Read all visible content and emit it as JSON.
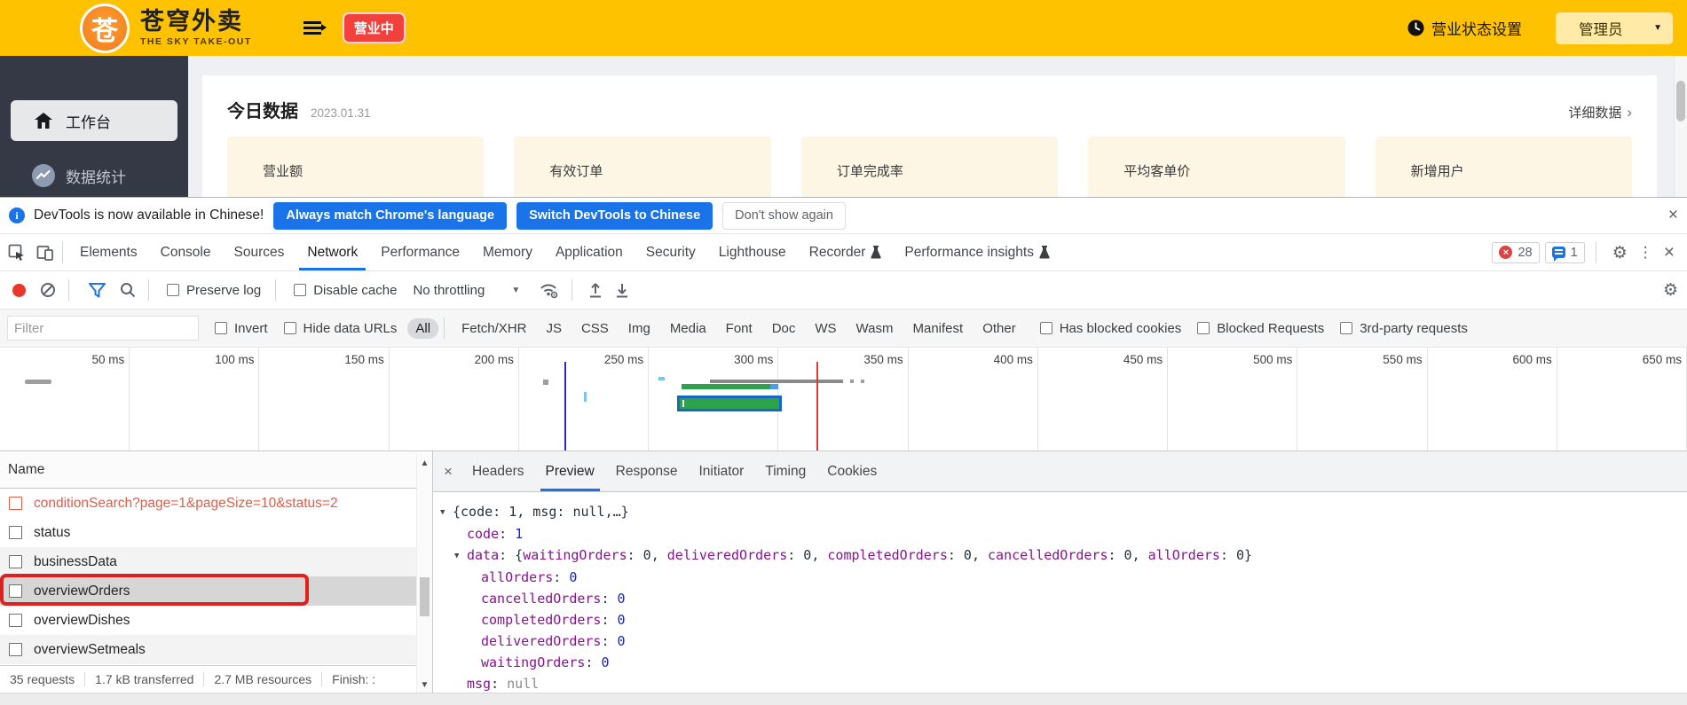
{
  "colors": {
    "brand_yellow": "#ffc200",
    "badge_red": "#f2413d",
    "sidebar_dark": "#353845",
    "card_cream": "#fdf6e4",
    "devtools_blue": "#1a73e8",
    "error_red": "#e05d47",
    "annotation_red": "#e01f1f",
    "waterfall_green": "#2ca24c"
  },
  "app": {
    "brand": {
      "logo_char": "苍",
      "title": "苍穹外卖",
      "subtitle": "THE SKY TAKE-OUT"
    },
    "status_badge": "营业中",
    "business_status_label": "营业状态设置",
    "user_menu": "管理员",
    "sidebar": [
      {
        "label": "工作台",
        "icon": "home-icon",
        "active": true
      },
      {
        "label": "数据统计",
        "icon": "line-chart-icon",
        "active": false
      }
    ],
    "main": {
      "section_title": "今日数据",
      "date": "2023.01.31",
      "detail_link": "详细数据",
      "detail_chevron": "›",
      "cards": [
        "营业额",
        "有效订单",
        "订单完成率",
        "平均客单价",
        "新增用户"
      ]
    }
  },
  "devtools": {
    "infobar": {
      "message": "DevTools is now available in Chinese!",
      "buttons": [
        {
          "label": "Always match Chrome's language",
          "style": "primary"
        },
        {
          "label": "Switch DevTools to Chinese",
          "style": "primary"
        },
        {
          "label": "Don't show again",
          "style": "secondary"
        }
      ],
      "close": "×"
    },
    "tabs": {
      "items": [
        "Elements",
        "Console",
        "Sources",
        "Network",
        "Performance",
        "Memory",
        "Application",
        "Security",
        "Lighthouse",
        "Recorder",
        "Performance insights"
      ],
      "selected": "Network",
      "flask_tabs": [
        "Recorder",
        "Performance insights"
      ],
      "error_count": "28",
      "issue_count": "1",
      "close": "×"
    },
    "toolbar": {
      "preserve_log": "Preserve log",
      "disable_cache": "Disable cache",
      "throttling": "No throttling"
    },
    "filterbar": {
      "placeholder": "Filter",
      "invert": "Invert",
      "hide_data_urls": "Hide data URLs",
      "types": [
        "All",
        "Fetch/XHR",
        "JS",
        "CSS",
        "Img",
        "Media",
        "Font",
        "Doc",
        "WS",
        "Wasm",
        "Manifest",
        "Other"
      ],
      "selected_type": "All",
      "more": [
        "Has blocked cookies",
        "Blocked Requests",
        "3rd-party requests"
      ]
    },
    "timeline": {
      "labels": [
        "50 ms",
        "100 ms",
        "150 ms",
        "200 ms",
        "250 ms",
        "300 ms",
        "350 ms",
        "400 ms",
        "450 ms",
        "500 ms",
        "550 ms",
        "600 ms",
        "650 ms"
      ]
    },
    "requests": {
      "header": "Name",
      "rows": [
        {
          "label": "conditionSearch?page=1&pageSize=10&status=2",
          "error": true
        },
        {
          "label": "status"
        },
        {
          "label": "businessData",
          "shaded": true
        },
        {
          "label": "overviewOrders",
          "selected": true,
          "annotated": true
        },
        {
          "label": "overviewDishes"
        },
        {
          "label": "overviewSetmeals",
          "shaded": true
        }
      ]
    },
    "preview": {
      "tabs": [
        "Headers",
        "Preview",
        "Response",
        "Initiator",
        "Timing",
        "Cookies"
      ],
      "selected": "Preview",
      "close": "×",
      "json": [
        {
          "indent": 0,
          "expanded": true,
          "parts": [
            [
              "{code: 1, msg: null,…}",
              "jp"
            ]
          ]
        },
        {
          "indent": 1,
          "expanded": false,
          "parts": [
            [
              "code",
              "jk"
            ],
            [
              ": ",
              "jp"
            ],
            [
              "1",
              "jn"
            ]
          ]
        },
        {
          "indent": 1,
          "expanded": true,
          "parts": [
            [
              "data",
              "jk"
            ],
            [
              ": {",
              "jp"
            ],
            [
              "waitingOrders",
              "jk"
            ],
            [
              ": 0, ",
              "jp"
            ],
            [
              "deliveredOrders",
              "jk"
            ],
            [
              ": 0, ",
              "jp"
            ],
            [
              "completedOrders",
              "jk"
            ],
            [
              ": 0, ",
              "jp"
            ],
            [
              "cancelledOrders",
              "jk"
            ],
            [
              ": 0, ",
              "jp"
            ],
            [
              "allOrders",
              "jk"
            ],
            [
              ": 0",
              "jp"
            ],
            [
              "}",
              "jp"
            ]
          ]
        },
        {
          "indent": 2,
          "expanded": false,
          "parts": [
            [
              "allOrders",
              "jk"
            ],
            [
              ": ",
              "jp"
            ],
            [
              "0",
              "jn"
            ]
          ]
        },
        {
          "indent": 2,
          "expanded": false,
          "parts": [
            [
              "cancelledOrders",
              "jk"
            ],
            [
              ": ",
              "jp"
            ],
            [
              "0",
              "jn"
            ]
          ]
        },
        {
          "indent": 2,
          "expanded": false,
          "parts": [
            [
              "completedOrders",
              "jk"
            ],
            [
              ": ",
              "jp"
            ],
            [
              "0",
              "jn"
            ]
          ]
        },
        {
          "indent": 2,
          "expanded": false,
          "parts": [
            [
              "deliveredOrders",
              "jk"
            ],
            [
              ": ",
              "jp"
            ],
            [
              "0",
              "jn"
            ]
          ]
        },
        {
          "indent": 2,
          "expanded": false,
          "parts": [
            [
              "waitingOrders",
              "jk"
            ],
            [
              ": ",
              "jp"
            ],
            [
              "0",
              "jn"
            ]
          ]
        },
        {
          "indent": 1,
          "expanded": false,
          "parts": [
            [
              "msg",
              "jk"
            ],
            [
              ": ",
              "jp"
            ],
            [
              "null",
              "jnull"
            ]
          ]
        }
      ]
    },
    "statusbar": [
      "35 requests",
      "1.7 kB transferred",
      "2.7 MB resources",
      "Finish: :"
    ]
  }
}
